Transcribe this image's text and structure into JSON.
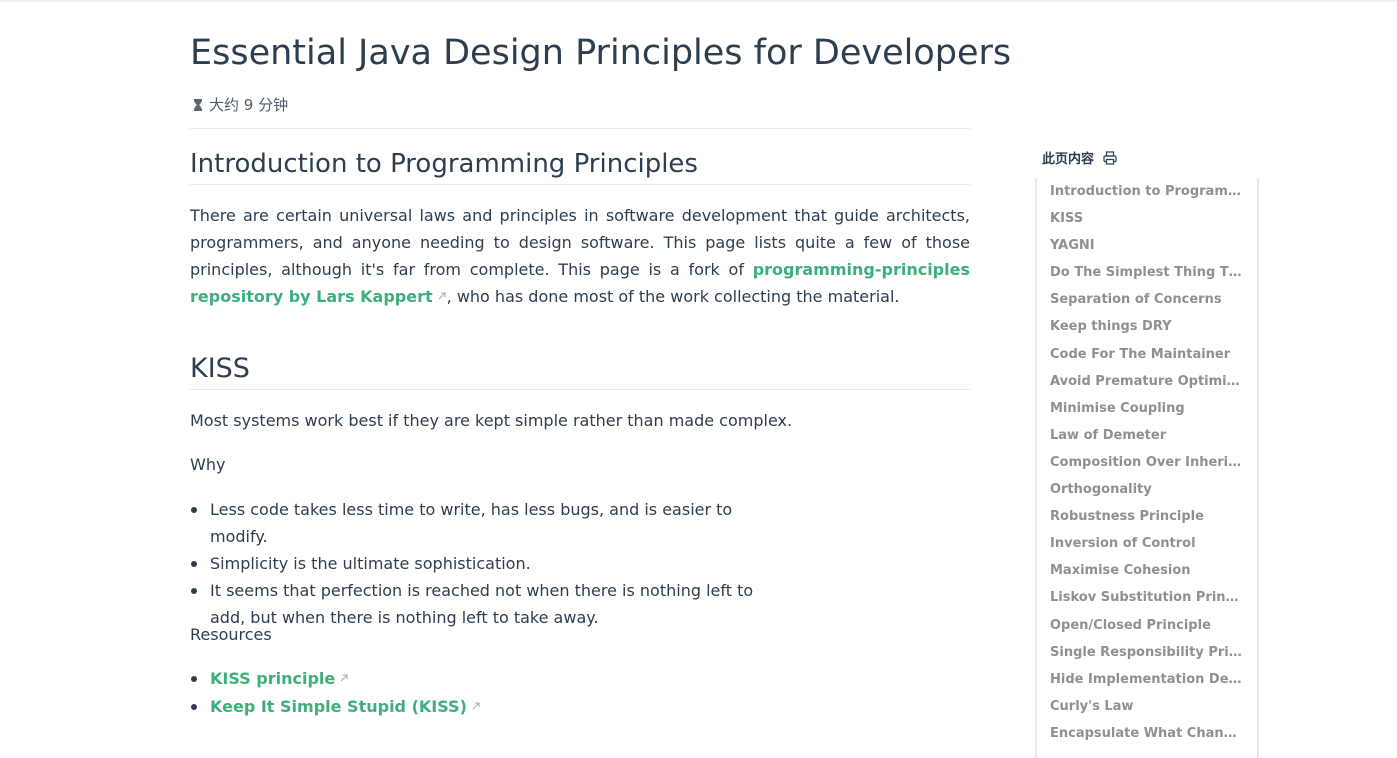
{
  "page": {
    "title": "Essential Java Design Principles for Developers",
    "reading_time": "大约 9 分钟"
  },
  "intro": {
    "heading": "Introduction to Programming Principles",
    "text_before_link": "There are certain universal laws and principles in software development that guide architects, programmers, and anyone needing to design software. This page lists quite a few of those principles, although it's far from complete. This page is a fork of ",
    "link_text": "programming-principles repository by Lars Kappert",
    "text_after_link": ", who has done most of the work collecting the material."
  },
  "kiss": {
    "heading": "KISS",
    "summary": "Most systems work best if they are kept simple rather than made complex.",
    "why_label": "Why",
    "why_items": [
      "Less code takes less time to write, has less bugs, and is easier to modify.",
      "Simplicity is the ultimate sophistication.",
      "It seems that perfection is reached not when there is nothing left to add, but when there is nothing left to take away."
    ],
    "resources_label": "Resources",
    "resources": [
      "KISS principle",
      "Keep It Simple Stupid (KISS)"
    ]
  },
  "toc": {
    "title": "此页内容",
    "print_icon": "printer-icon",
    "items": [
      "Introduction to Programmin...",
      "KISS",
      "YAGNI",
      "Do The Simplest Thing That ...",
      "Separation of Concerns",
      "Keep things DRY",
      "Code For The Maintainer",
      "Avoid Premature Optimization",
      "Minimise Coupling",
      "Law of Demeter",
      "Composition Over Inheritance",
      "Orthogonality",
      "Robustness Principle",
      "Inversion of Control",
      "Maximise Cohesion",
      "Liskov Substitution Principle",
      "Open/Closed Principle",
      "Single Responsibility Principle",
      "Hide Implementation Details",
      "Curly's Law",
      "Encapsulate What Changes"
    ]
  },
  "colors": {
    "text": "#2c3e50",
    "accent": "#3eaf7c",
    "muted": "#8c9196",
    "rule": "#e6e8eb"
  }
}
